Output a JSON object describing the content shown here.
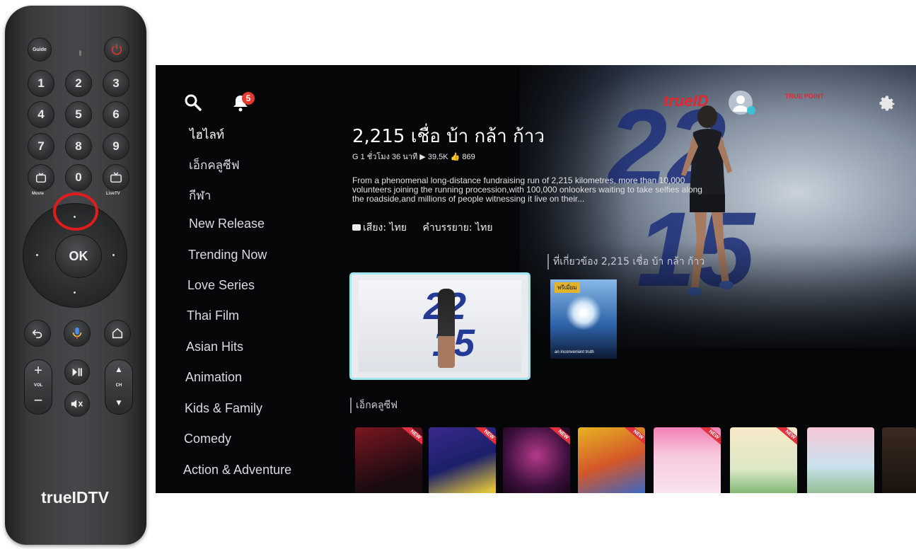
{
  "remote": {
    "guide_label": "Guide",
    "keys": [
      "1",
      "2",
      "3",
      "4",
      "5",
      "6",
      "7",
      "8",
      "9",
      "0"
    ],
    "movie_label": "Movie",
    "livetv_label": "LiveTV",
    "ok_label": "OK",
    "vol_label": "VOL",
    "ch_label": "CH",
    "brand": "trueIDTV"
  },
  "screen": {
    "notification_count": "5",
    "nav": [
      "ไฮไลท์",
      "เอ็กคลูซีฟ",
      "กีฬา",
      "New Release",
      "Trending Now",
      "Love Series",
      "Thai Film",
      "Asian Hits",
      "Animation",
      "Kids & Family",
      "Comedy",
      "Action & Adventure"
    ],
    "title": "2,215 เชื่อ บ้า กล้า ก้าว",
    "meta": "G  1 ชั่วโมง 36 นาที  ▶ 39.5K  👍 869",
    "description": "From a phenomenal long-distance fundraising run of 2,215 kilometres, more than 10,000 volunteers joining the running procession,with 100,000 onlookers waiting to take selfies along the roadside,and millions of people witnessing it live on their...",
    "audio": "เสียง: ไทย",
    "subtitle": "คำบรรยาย: ไทย",
    "related_label": "ที่เกี่ยวข้อง 2,215 เชื่อ บ้า กล้า ก้าว",
    "premium_tag": "พรีเมี่ยม",
    "poster2_caption": "an inconvenient truth",
    "exclusive_label": "เอ็กคลูซีฟ",
    "new_badge": "NEW",
    "brand_logo": "trueID",
    "true_point": "TRUE POINT",
    "hero_number": "2215"
  },
  "colors": {
    "accent_cyan": "#9fe6f0",
    "badge_red": "#e4313f",
    "remote_power": "#d23a2c",
    "brand_red": "#e5262e"
  }
}
